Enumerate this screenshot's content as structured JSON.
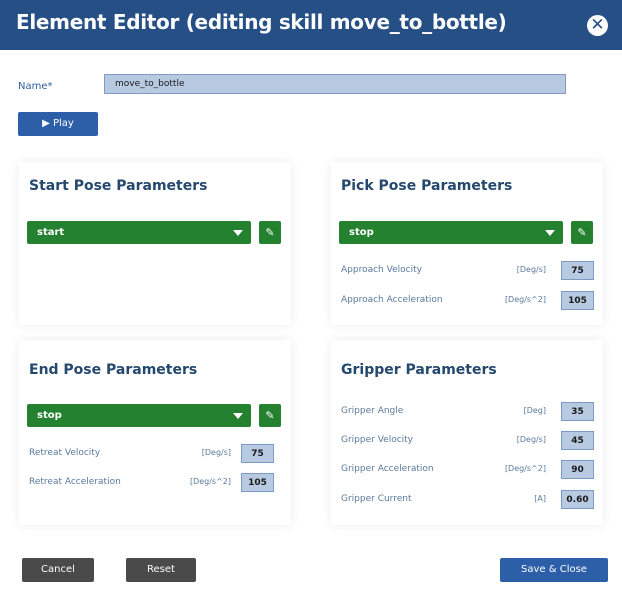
{
  "dialog": {
    "title": "Element Editor (editing skill move_to_bottle)",
    "close_icon": "close-icon",
    "name_label": "Name*",
    "name_value": "move_to_bottle",
    "play_label": "▶ Play"
  },
  "start_pose": {
    "title": "Start Pose Parameters",
    "selected": "start"
  },
  "pick_pose": {
    "title": "Pick Pose Parameters",
    "selected": "stop",
    "params": [
      {
        "label": "Approach Velocity",
        "unit": "[Deg/s]",
        "value": "75"
      },
      {
        "label": "Approach Acceleration",
        "unit": "[Deg/s^2]",
        "value": "105"
      }
    ]
  },
  "end_pose": {
    "title": "End Pose Parameters",
    "selected": "stop",
    "params": [
      {
        "label": "Retreat Velocity",
        "unit": "[Deg/s]",
        "value": "75"
      },
      {
        "label": "Retreat Acceleration",
        "unit": "[Deg/s^2]",
        "value": "105"
      }
    ]
  },
  "gripper": {
    "title": "Gripper Parameters",
    "params": [
      {
        "label": "Gripper Angle",
        "unit": "[Deg]",
        "value": "35"
      },
      {
        "label": "Gripper Velocity",
        "unit": "[Deg/s]",
        "value": "45"
      },
      {
        "label": "Gripper Acceleration",
        "unit": "[Deg/s^2]",
        "value": "90"
      },
      {
        "label": "Gripper Current",
        "unit": "[A]",
        "value": "0.60"
      }
    ]
  },
  "footer": {
    "cancel_label": "Cancel",
    "reset_label": "Reset",
    "save_label": "Save & Close"
  },
  "colors": {
    "title_bar": "#254f85",
    "green": "#24812f",
    "blue_button": "#2d5fa8",
    "gray_button": "#4a4a4a",
    "input_fill": "#b8cae2"
  }
}
